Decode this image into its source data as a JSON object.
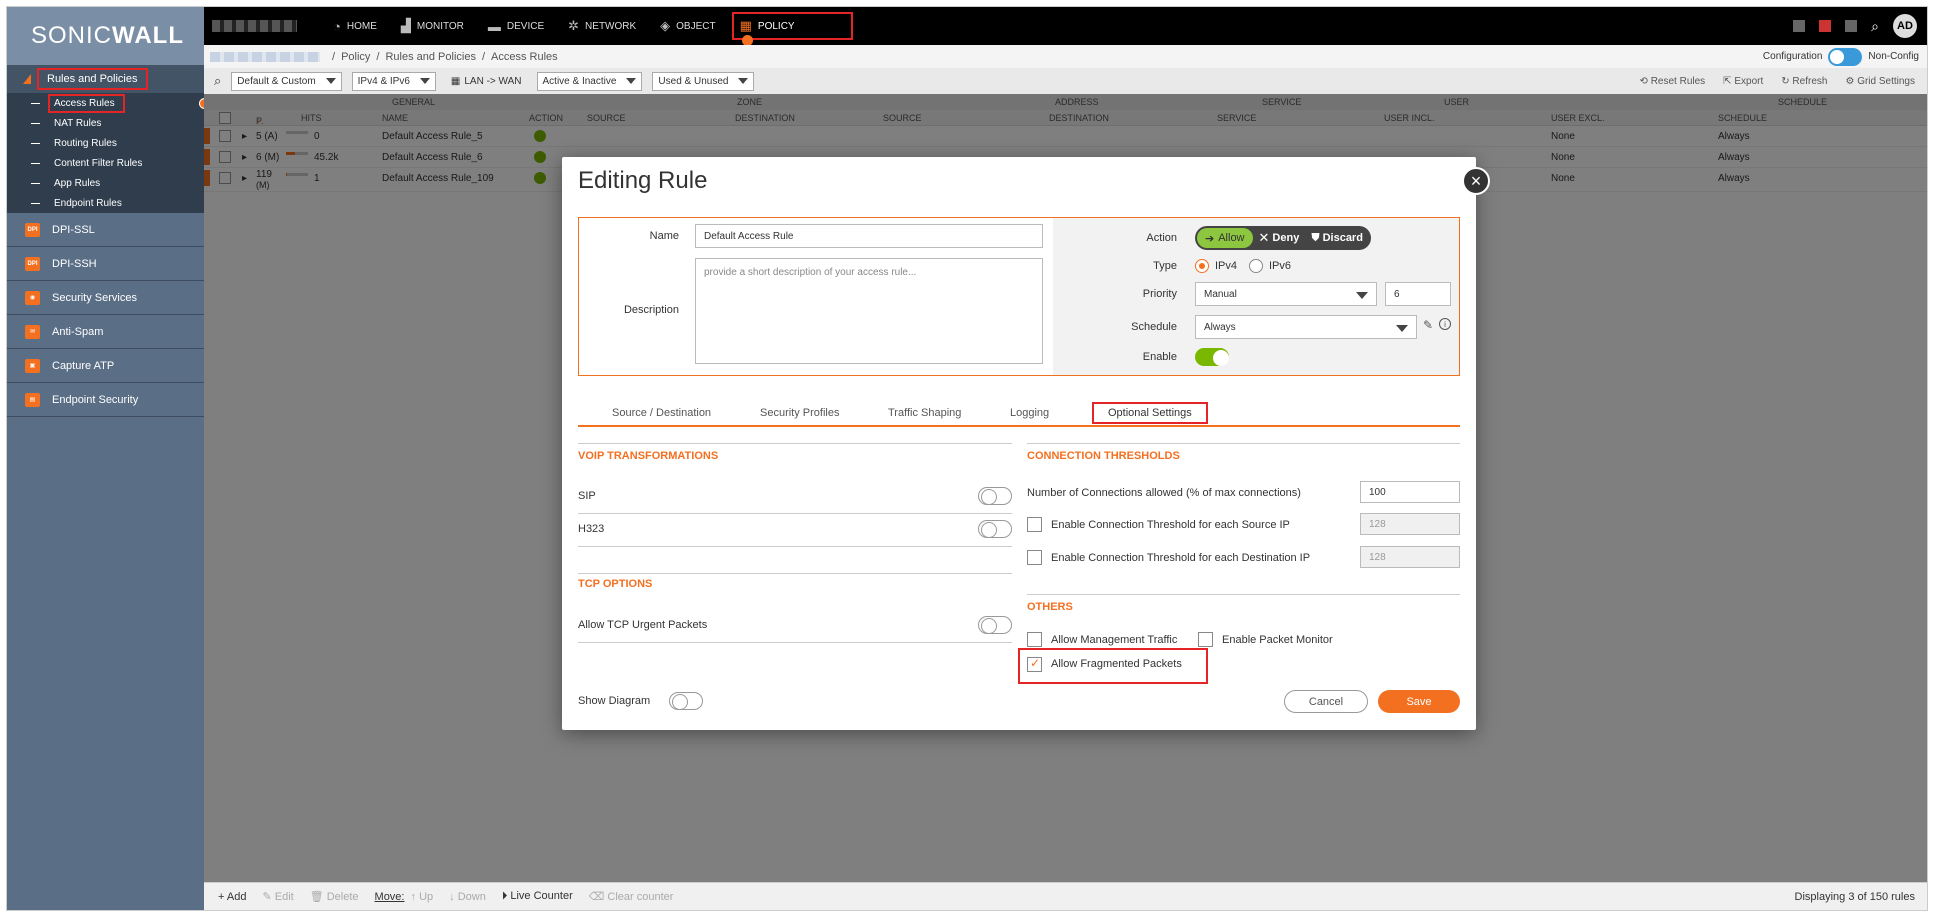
{
  "brand": {
    "logo_light": "SONIC",
    "logo_bold": "WALL"
  },
  "topnav": {
    "items": [
      {
        "label": "HOME",
        "icon": "gauge-icon"
      },
      {
        "label": "MONITOR",
        "icon": "chart-icon"
      },
      {
        "label": "DEVICE",
        "icon": "monitor-icon"
      },
      {
        "label": "NETWORK",
        "icon": "network-icon"
      },
      {
        "label": "OBJECT",
        "icon": "cube-icon"
      },
      {
        "label": "POLICY",
        "icon": "policy-icon"
      }
    ],
    "active": "POLICY",
    "user_initials": "AD"
  },
  "breadcrumb": {
    "items": [
      "Policy",
      "Rules and Policies",
      "Access Rules"
    ]
  },
  "config_toggle": {
    "left": "Configuration",
    "right": "Non-Config"
  },
  "sidebar": {
    "section": "Rules and Policies",
    "subitems": [
      "Access Rules",
      "NAT Rules",
      "Routing Rules",
      "Content Filter Rules",
      "App Rules",
      "Endpoint Rules"
    ],
    "active_sub": "Access Rules",
    "items": [
      {
        "label": "DPI-SSL",
        "icon": "DPI SSL"
      },
      {
        "label": "DPI-SSH",
        "icon": "DPI SSH"
      },
      {
        "label": "Security Services",
        "icon": "shield"
      },
      {
        "label": "Anti-Spam",
        "icon": "spam"
      },
      {
        "label": "Capture ATP",
        "icon": "capture"
      },
      {
        "label": "Endpoint Security",
        "icon": "endpoint"
      }
    ]
  },
  "toolbar": {
    "filters": [
      "Default & Custom",
      "IPv4 & IPv6",
      "LAN -> WAN",
      "Active & Inactive",
      "Used & Unused"
    ],
    "actions": [
      "Reset Rules",
      "Export",
      "Refresh",
      "Grid Settings"
    ]
  },
  "table": {
    "groups": [
      "GENERAL",
      "ZONE",
      "ADDRESS",
      "SERVICE",
      "USER",
      "SCHEDULE"
    ],
    "columns": [
      "P.",
      "HITS",
      "NAME",
      "ACTION",
      "SOURCE",
      "DESTINATION",
      "SOURCE",
      "DESTINATION",
      "SERVICE",
      "USER INCL.",
      "USER EXCL.",
      "SCHEDULE"
    ],
    "rows": [
      {
        "priority": "5 (A)",
        "hits": "0",
        "hit_fraction": 0.0,
        "name": "Default Access Rule_5",
        "user_excl": "None",
        "schedule": "Always"
      },
      {
        "priority": "6 (M)",
        "hits": "45.2k",
        "hit_fraction": 0.4,
        "name": "Default Access Rule_6",
        "user_excl": "None",
        "schedule": "Always"
      },
      {
        "priority": "119",
        "priority_sub": "(M)",
        "hits": "1",
        "hit_fraction": 0.05,
        "name": "Default Access Rule_109",
        "user_excl": "None",
        "schedule": "Always"
      }
    ]
  },
  "bottombar": {
    "add": "Add",
    "edit": "Edit",
    "delete": "Delete",
    "move": "Move:",
    "up": "Up",
    "down": "Down",
    "live_counter": "Live Counter",
    "clear_counter": "Clear counter",
    "display": "Displaying 3 of 150 rules"
  },
  "modal": {
    "title": "Editing Rule",
    "name_label": "Name",
    "name_value": "Default Access Rule",
    "description_label": "Description",
    "description_placeholder": "provide a short description of your access rule...",
    "action_label": "Action",
    "action_options": [
      "Allow",
      "Deny",
      "Discard"
    ],
    "action_selected": "Allow",
    "type_label": "Type",
    "type_options": [
      "IPv4",
      "IPv6"
    ],
    "type_selected": "IPv4",
    "priority_label": "Priority",
    "priority_mode": "Manual",
    "priority_value": "6",
    "schedule_label": "Schedule",
    "schedule_value": "Always",
    "enable_label": "Enable",
    "enable_on": true,
    "tabs": [
      "Source / Destination",
      "Security Profiles",
      "Traffic Shaping",
      "Logging",
      "Optional Settings"
    ],
    "active_tab": "Optional Settings",
    "voip_title": "VOIP TRANSFORMATIONS",
    "sip_label": "SIP",
    "h323_label": "H323",
    "tcp_title": "TCP OPTIONS",
    "tcp_urgent_label": "Allow TCP Urgent Packets",
    "conn_title": "CONNECTION THRESHOLDS",
    "conn_allowed_label": "Number of Connections allowed (% of max connections)",
    "conn_allowed_value": "100",
    "conn_src_label": "Enable Connection Threshold for each Source IP",
    "conn_src_value": "128",
    "conn_dst_label": "Enable Connection Threshold for each Destination IP",
    "conn_dst_value": "128",
    "others_title": "OTHERS",
    "mgmt_label": "Allow Management Traffic",
    "pktmon_label": "Enable Packet Monitor",
    "frag_label": "Allow Fragmented Packets",
    "frag_checked": true,
    "show_diagram_label": "Show Diagram",
    "cancel": "Cancel",
    "save": "Save"
  },
  "colors": {
    "accent": "#f37021",
    "allow": "#8dc63f",
    "highlight": "#e52525"
  }
}
